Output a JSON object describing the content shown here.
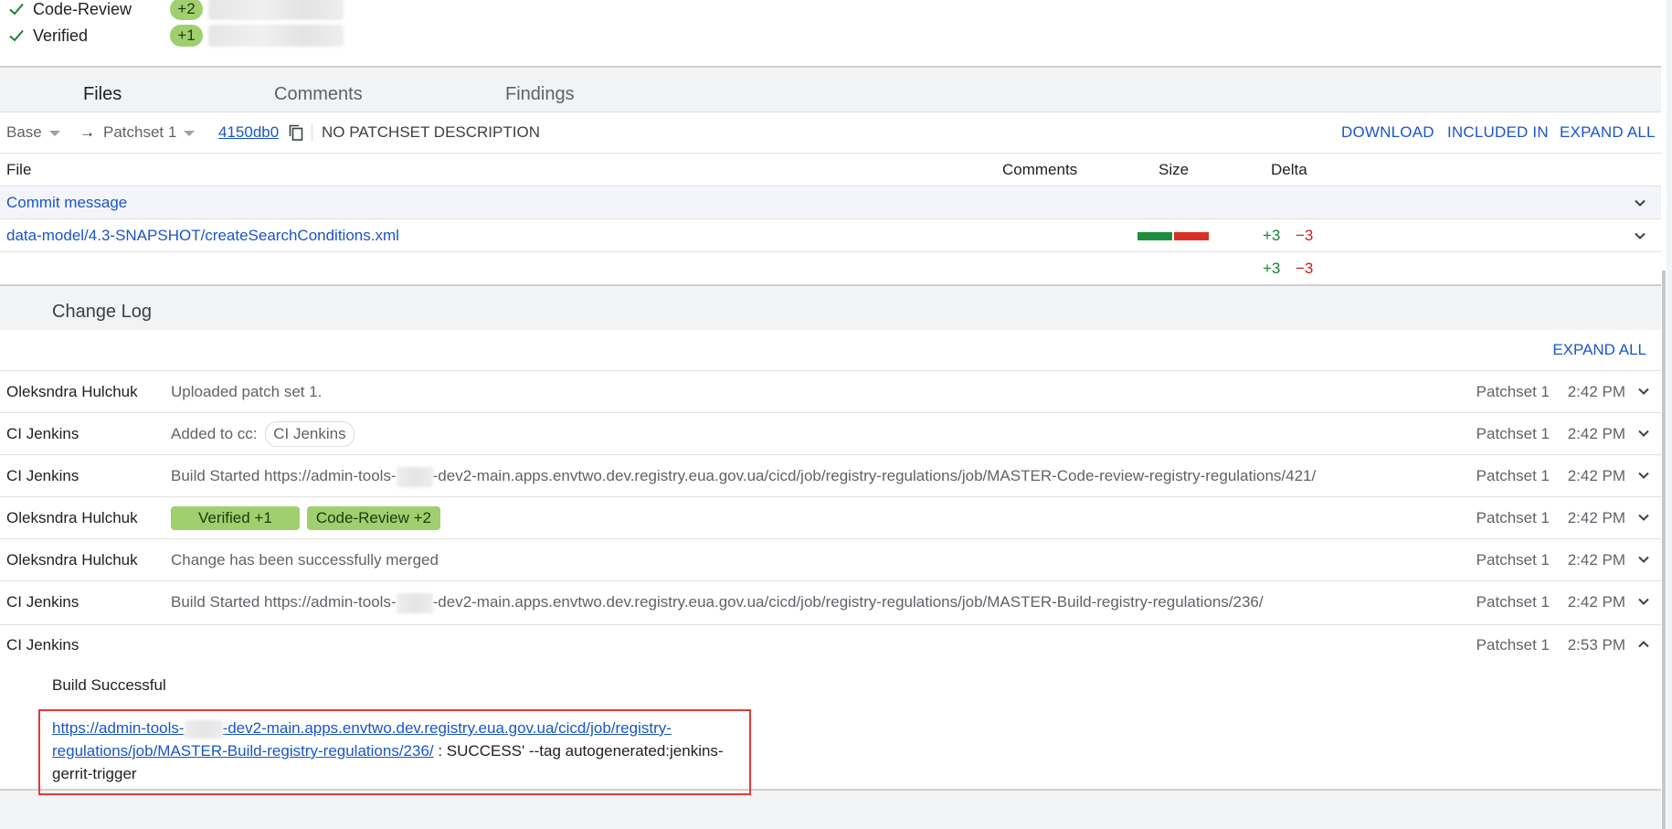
{
  "labels": [
    {
      "name": "Code-Review",
      "vote": "+2"
    },
    {
      "name": "Verified",
      "vote": "+1"
    }
  ],
  "tabs": [
    "Files",
    "Comments",
    "Findings"
  ],
  "patchbar": {
    "base": "Base",
    "arrow": "→",
    "patchset": "Patchset 1",
    "commit_hash": "4150db0",
    "description": "NO PATCHSET DESCRIPTION",
    "download": "DOWNLOAD",
    "included_in": "INCLUDED IN",
    "expand_all": "EXPAND ALL"
  },
  "file_table": {
    "headers": {
      "file": "File",
      "comments": "Comments",
      "size": "Size",
      "delta": "Delta"
    },
    "commit_message": "Commit message",
    "files": [
      {
        "path": "data-model/4.3-SNAPSHOT/createSearchConditions.xml",
        "added": "+3",
        "removed": "−3",
        "size_added_fraction": 0.5,
        "size_removed_fraction": 0.5
      }
    ],
    "totals": {
      "added": "+3",
      "removed": "−3"
    }
  },
  "change_log": {
    "title": "Change Log",
    "expand_all": "EXPAND ALL",
    "messages": [
      {
        "author": "Oleksndra Hulchuk",
        "summary": "Uploaded patch set 1.",
        "patchset": "Patchset 1",
        "time": "2:42 PM"
      },
      {
        "author": "CI Jenkins",
        "summary_prefix": "Added to cc:",
        "cc": "CI Jenkins",
        "patchset": "Patchset 1",
        "time": "2:42 PM"
      },
      {
        "author": "CI Jenkins",
        "summary_a": "Build Started https://admin-tools-",
        "summary_b": "-dev2-main.apps.envtwo.dev.registry.eua.gov.ua/cicd/job/registry-regulations/job/MASTER-Code-review-registry-regulations/421/",
        "patchset": "Patchset 1",
        "time": "2:42 PM"
      },
      {
        "author": "Oleksndra Hulchuk",
        "votes": [
          "Verified +1",
          "Code-Review +2"
        ],
        "patchset": "Patchset 1",
        "time": "2:42 PM"
      },
      {
        "author": "Oleksndra Hulchuk",
        "summary": "Change has been successfully merged",
        "patchset": "Patchset 1",
        "time": "2:42 PM"
      },
      {
        "author": "CI Jenkins",
        "summary_a": "Build Started https://admin-tools-",
        "summary_b": "-dev2-main.apps.envtwo.dev.registry.eua.gov.ua/cicd/job/registry-regulations/job/MASTER-Build-registry-regulations/236/",
        "patchset": "Patchset 1",
        "time": "2:42 PM"
      }
    ],
    "expanded": {
      "author": "CI Jenkins",
      "patchset": "Patchset 1",
      "time": "2:53 PM",
      "body_title": "Build Successful",
      "link_a": "https://admin-tools-",
      "link_b": "-dev2-main.apps.envtwo.dev.registry.eua.gov.ua/cicd/job/registry-regulations/job/MASTER-Build-registry-regulations/236/",
      "trailer": " : SUCCESS'   --tag autogenerated:jenkins-gerrit-trigger"
    }
  },
  "colors": {
    "link": "#1a55c8",
    "vote_green": "#9fcf6e",
    "added": "#188038",
    "removed": "#c5221f",
    "highlight_box": "#e53935"
  }
}
